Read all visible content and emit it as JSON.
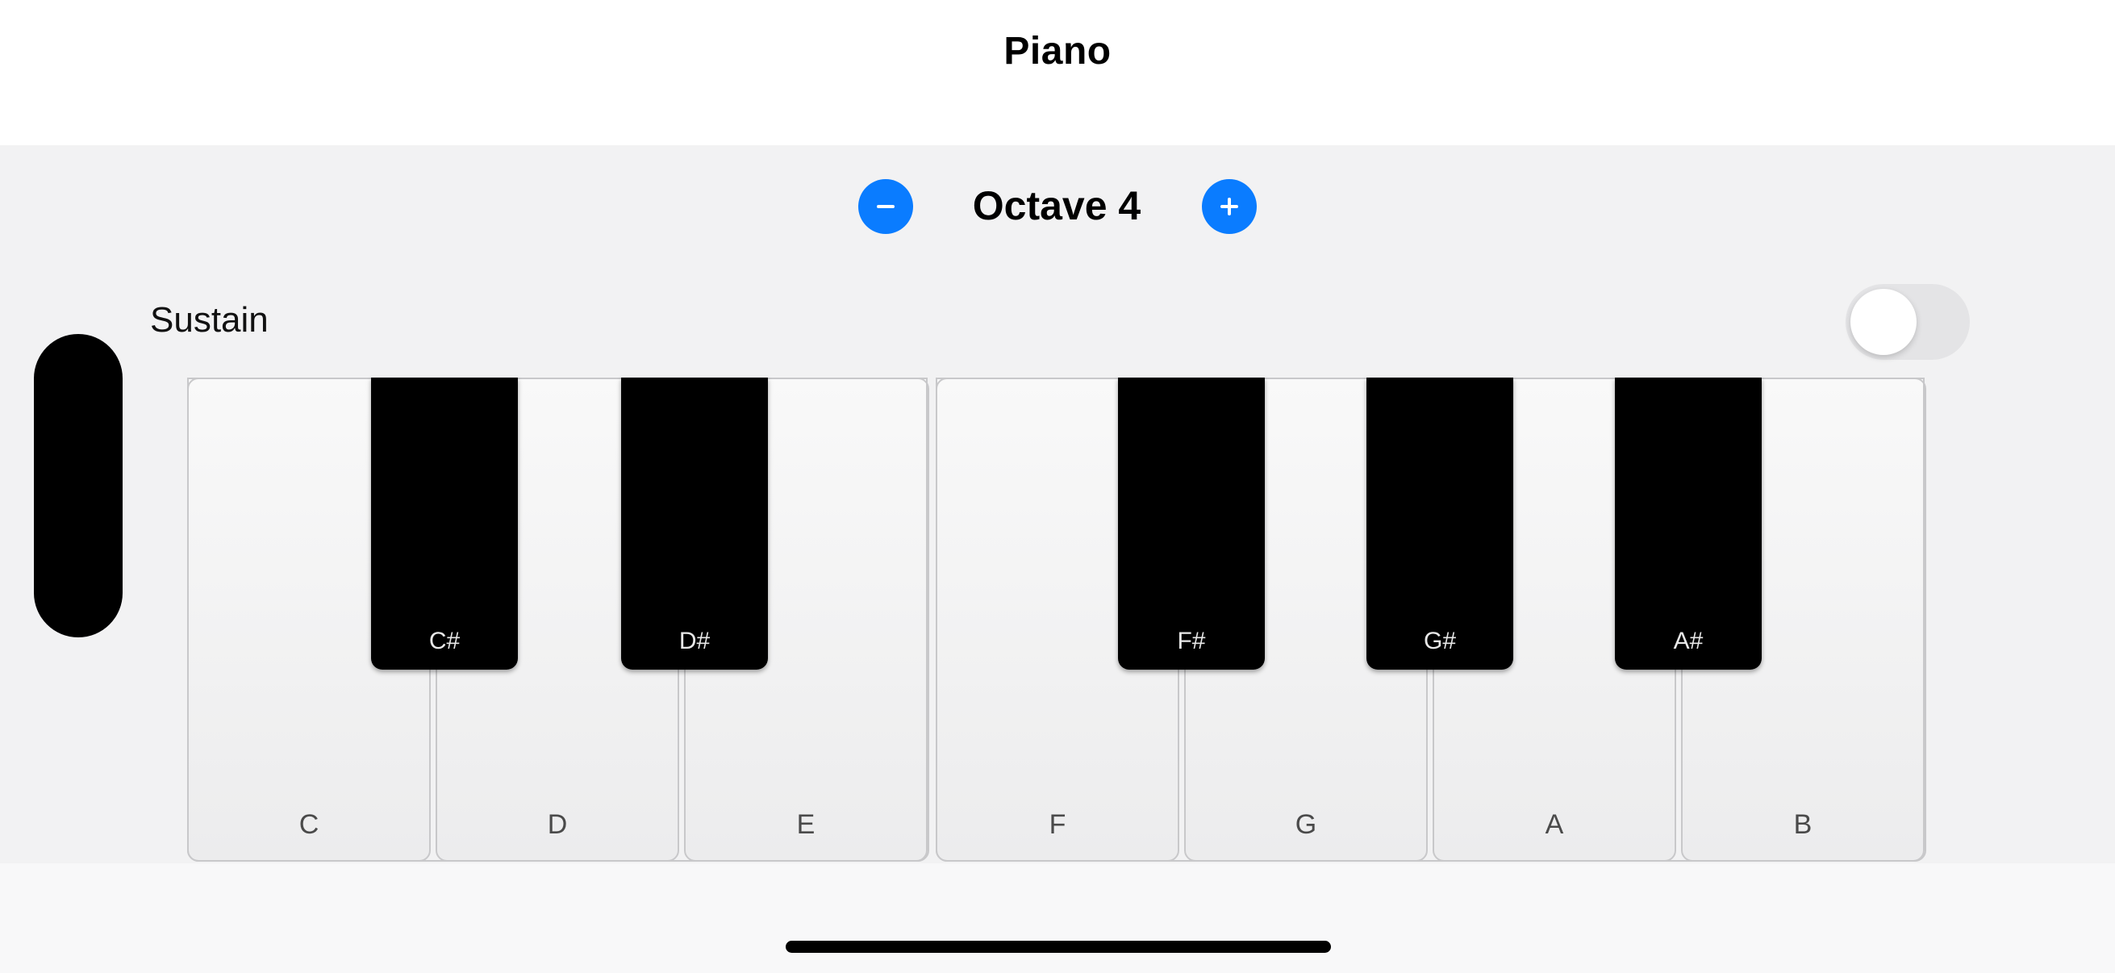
{
  "header": {
    "title": "Piano"
  },
  "octave": {
    "label": "Octave 4",
    "decrement_icon": "minus-icon",
    "increment_icon": "plus-icon",
    "accent": "#0a7cff"
  },
  "sustain": {
    "label": "Sustain",
    "enabled": false
  },
  "keys": {
    "white": [
      "C",
      "D",
      "E",
      "F",
      "G",
      "A",
      "B"
    ],
    "black": [
      "C#",
      "D#",
      "F#",
      "G#",
      "A#"
    ]
  }
}
